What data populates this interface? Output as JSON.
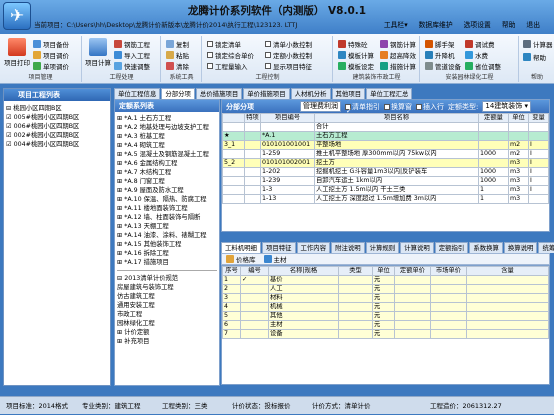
{
  "title": "龙腾计价系列软件（内测版） V8.0.1",
  "file_path": "当前项目：C:\\Users\\hh\\Desktop\\龙腾计价新版本\\龙腾计价2014\\执行工程\\123123. LTTJ",
  "menu": [
    "工具栏▾",
    "数据库维护",
    "选项设置",
    "帮助",
    "退出"
  ],
  "ribbon": {
    "g1": {
      "big": "项目打印",
      "items": [
        "项目备份",
        "项目调价",
        "单项调价"
      ],
      "label": "项目管理"
    },
    "g2": {
      "big": "项目计算",
      "items": [
        "钢筋工程",
        "导入工程",
        "快速调整"
      ],
      "label": "工程处理"
    },
    "g3": {
      "items": [
        "复制",
        "粘贴",
        "清除"
      ],
      "label": "系统工具"
    },
    "g4": {
      "items": [
        "锁定清单",
        "锁定综合单价",
        "工程量输入"
      ],
      "items2": [
        "清单小数控制",
        "定额小数控制",
        "显示项目特征"
      ],
      "label": "工程控制"
    },
    "g5": {
      "items": [
        "特殊砼",
        "模板计算",
        "模板设定"
      ],
      "items2": [
        "钢筋计算",
        "超高降效",
        "措施计算"
      ],
      "label": "建筑装饰市政工程"
    },
    "g6": {
      "items": [
        "脚手架",
        "升降机",
        "管道设备"
      ],
      "items2": [
        "调试费",
        "水费",
        "省位调整"
      ],
      "items3": [
        "数字高层建筑装修加费"
      ],
      "label": "安装园林绿化工程"
    },
    "g7": {
      "items": [
        "计算器",
        "帮助"
      ],
      "label": "帮助"
    }
  },
  "left": {
    "title": "项目工程列表",
    "tree": [
      "⊟ 桃园小区四期B区",
      "  ☑ 005#桃园小区四期B区",
      "  ☑ 006#桃园小区四期B区",
      "  ☑ 002#桃园小区四期B区",
      "  ☑ 004#桃园小区四期B区"
    ]
  },
  "top_tabs": [
    "单位工程信息",
    "分部分项",
    "总价措施项目",
    "单价措施项目",
    "人材机分析",
    "其他项目",
    "单位工程汇总"
  ],
  "mid": {
    "title": "定额系列表",
    "tree": [
      "⊞ *A.1 土石方工程",
      "⊞ *A.2 地基处理与边坡支护工程",
      "⊞ *A.3 桩基工程",
      "⊞ *A.4 砌筑工程",
      "⊞ *A.5 混凝土及钢筋混凝土工程",
      "⊞ *A.6 金属结构工程",
      "⊞ *A.7 木结构工程",
      "⊞ *A.8 门窗工程",
      "⊞ *A.9 屋面及防水工程",
      "⊞ *A.10 保温、隔热、防腐工程",
      "⊞ *A.11 楼地面装饰工程",
      "⊞ *A.12 墙、柱面装饰与隔断",
      "⊞ *A.13 天棚工程",
      "⊞ *A.14 油漆、涂料、裱糊工程",
      "⊞ *A.15 其他装饰工程",
      "⊞ *A.16 拆除工程",
      "⊞ *A.17 措施项目"
    ],
    "tree2": [
      "⊟ 2013清单计价规范",
      "    房屋建筑与装饰工程",
      "    仿古建筑工程",
      "    通用安装工程",
      "    市政工程",
      "    园林绿化工程",
      "⊞ 计价定额",
      "⊞ 补充项目"
    ]
  },
  "grid": {
    "title": "分部分项",
    "btn1": "管理费利润",
    "chk1": "清单指引",
    "chk2": "换算窗",
    "chk3": "插入行",
    "type_label": "定额类型:",
    "type_value": "14建筑装饰 ▾",
    "cols": [
      "",
      "特项",
      "项目编号",
      "项目名称",
      "定额量",
      "单位",
      "变量"
    ],
    "rows": [
      [
        "",
        "",
        "",
        "合计",
        "",
        "",
        ""
      ],
      [
        "★",
        "",
        "*A.1",
        "土石方工程",
        "",
        "",
        ""
      ],
      [
        "3_1",
        "",
        "010101001001",
        "平整场地",
        "",
        "m2",
        "Ⅰ"
      ],
      [
        "",
        "",
        "1-259",
        "推土机平整场地 厚300mm以内 75kw以内",
        "1000",
        "m2",
        "Ⅰ"
      ],
      [
        "5_2",
        "",
        "010101002001",
        "挖土方",
        "",
        "m3",
        "Ⅰ"
      ],
      [
        "",
        "",
        "1-202",
        "挖掘机挖土 G斗容量1m3以内|反铲装车",
        "1000",
        "m3",
        "Ⅰ"
      ],
      [
        "",
        "",
        "1-239",
        "自卸汽车运土 1km以内",
        "1000",
        "m3",
        "Ⅰ"
      ],
      [
        "",
        "",
        "1-3",
        "人工挖土方 1.5m以内 干土三类",
        "1",
        "m3",
        "Ⅰ"
      ],
      [
        "",
        "",
        "1-13",
        "人工挖土方 深度超过 1.5m增加费 3m以内",
        "1",
        "m3",
        ""
      ]
    ]
  },
  "bottom_tabs": [
    "工料机明细",
    "项目特征",
    "工作内容",
    "附注说明",
    "计算规则",
    "计算说明",
    "定额指引",
    "系数换算",
    "换算说明",
    "统筹法计算"
  ],
  "bottom_tools": [
    "价格库",
    "主材"
  ],
  "bgrid": {
    "cols": [
      "序号",
      "编号",
      "名称|规格",
      "类型",
      "单位",
      "定额单价",
      "市场单价",
      "含量"
    ],
    "rows": [
      [
        "1",
        "✓",
        "基价",
        "",
        "元",
        "",
        "",
        ""
      ],
      [
        "2",
        "",
        "人工",
        "",
        "元",
        "",
        "",
        ""
      ],
      [
        "3",
        "",
        "材料",
        "",
        "元",
        "",
        "",
        ""
      ],
      [
        "4",
        "",
        "机械",
        "",
        "元",
        "",
        "",
        ""
      ],
      [
        "5",
        "",
        "其他",
        "",
        "元",
        "",
        "",
        ""
      ],
      [
        "6",
        "",
        "主材",
        "",
        "元",
        "",
        "",
        ""
      ],
      [
        "7",
        "",
        "设备",
        "",
        "元",
        "",
        "",
        ""
      ]
    ]
  },
  "status": [
    "项目标准：2014格式",
    "专业类别：建筑工程",
    "工程类别：三类",
    "计价状态：投标报价",
    "计价方式：清单计价",
    "工程造价：2061312.27"
  ]
}
